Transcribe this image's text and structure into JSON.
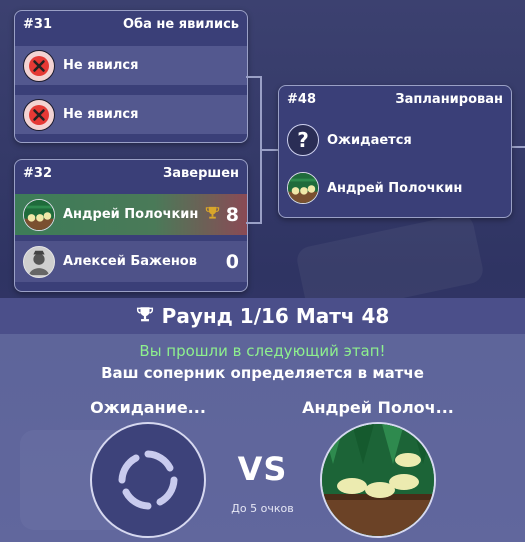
{
  "match31": {
    "number": "#31",
    "status": "Оба не явились",
    "players": [
      {
        "name": "Не явился",
        "avatar": "no-show-x-icon"
      },
      {
        "name": "Не явился",
        "avatar": "no-show-x-icon"
      }
    ]
  },
  "match32": {
    "number": "#32",
    "status": "Завершен",
    "players": [
      {
        "name": "Андрей Полочкин",
        "score": "8",
        "winner": true,
        "avatar": "backgammon-board-avatar"
      },
      {
        "name": "Алексей Баженов",
        "score": "0",
        "winner": false,
        "avatar": "photo-avatar"
      }
    ]
  },
  "match48": {
    "number": "#48",
    "status": "Запланирован",
    "players": [
      {
        "name": "Ожидается",
        "avatar": "question-mark-icon"
      },
      {
        "name": "Андрей Полочкин",
        "avatar": "backgammon-board-avatar"
      }
    ]
  },
  "panel": {
    "title": "Раунд 1/16 Матч 48",
    "advanced_message": "Вы прошли в следующий этап!",
    "opponent_message": "Ваш соперник определяется в матче",
    "left_player": "Ожидание...",
    "right_player": "Андрей Полоч...",
    "vs": "VS",
    "best_of": "До 5 очков"
  },
  "colors": {
    "background": "#343866",
    "card": "#3a3f78",
    "winner_row": "#3d7c58",
    "green_text": "#8ef08e",
    "trophy": "#d9a62a"
  }
}
